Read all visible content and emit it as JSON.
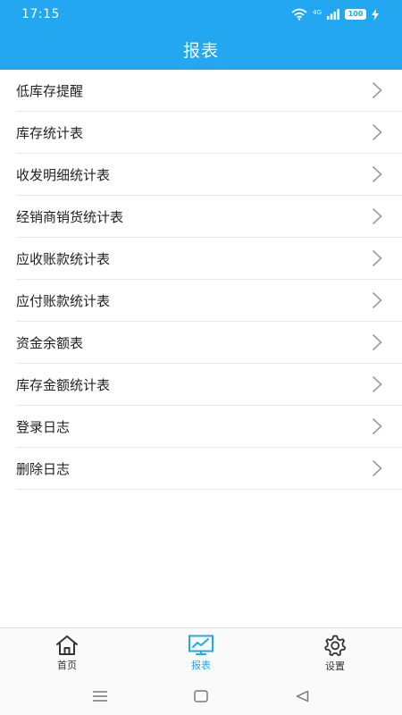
{
  "status_bar": {
    "time": "17:15",
    "signal_label": "4G",
    "battery": "100"
  },
  "header": {
    "title": "报表"
  },
  "reports": [
    {
      "label": "低库存提醒"
    },
    {
      "label": "库存统计表"
    },
    {
      "label": "收发明细统计表"
    },
    {
      "label": "经销商销货统计表"
    },
    {
      "label": "应收账款统计表"
    },
    {
      "label": "应付账款统计表"
    },
    {
      "label": "资金余额表"
    },
    {
      "label": "库存金额统计表"
    },
    {
      "label": "登录日志"
    },
    {
      "label": "删除日志"
    }
  ],
  "tabs": [
    {
      "label": "首页",
      "icon": "home-icon",
      "active": false
    },
    {
      "label": "报表",
      "icon": "chart-monitor-icon",
      "active": true
    },
    {
      "label": "设置",
      "icon": "gear-icon",
      "active": false
    }
  ],
  "colors": {
    "accent": "#22a7f0",
    "divider": "#e6e6e6",
    "chevron": "#9a9a9a"
  }
}
